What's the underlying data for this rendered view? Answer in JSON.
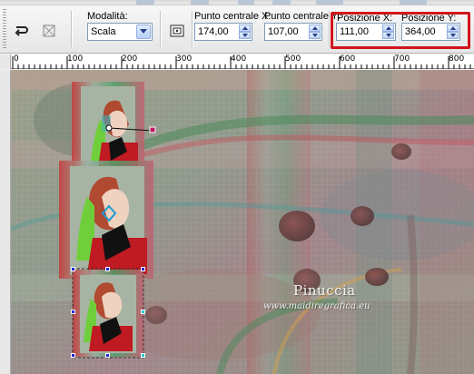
{
  "toolbar": {
    "mode_label": "Modalità:",
    "mode_value": "Scala",
    "center_x_label": "Punto centrale X:",
    "center_x_value": "174,00",
    "center_y_label": "Punto centrale Y:",
    "center_y_value": "107,00",
    "pos_x_label": "Posizione X:",
    "pos_x_value": "111,00",
    "pos_y_label": "Posizione Y:",
    "pos_y_value": "364,00",
    "highlight_color": "#d0141c"
  },
  "ruler": {
    "labels": [
      "0",
      "100",
      "200",
      "300",
      "400",
      "500",
      "600",
      "700",
      "800"
    ]
  },
  "canvas": {
    "watermark_title": "Pinuccia",
    "watermark_url": "www.maidiregrafica.eu"
  }
}
